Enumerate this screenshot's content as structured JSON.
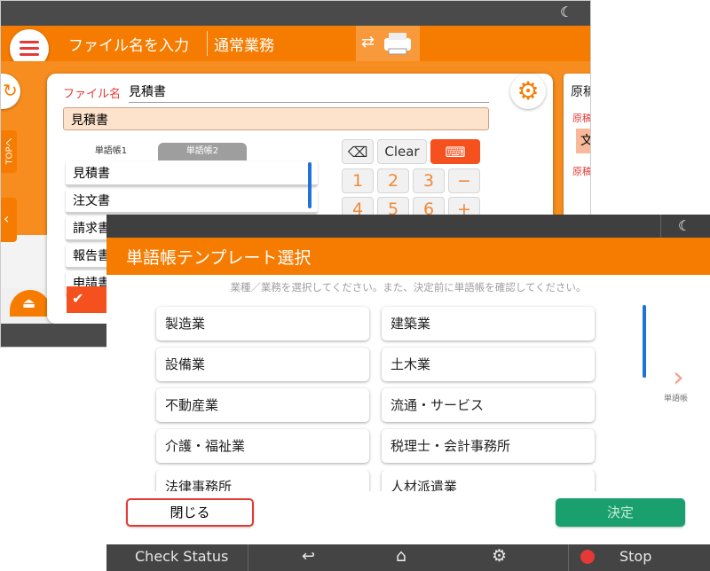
{
  "back_screen": {
    "header": {
      "filename_title": "ファイル名を入力",
      "mode": "通常業務"
    },
    "side_tab": "TOPへ",
    "filename_label": "ファイル名",
    "filename_value": "見積書",
    "preview_value": "見積書",
    "tabs": [
      "単語帳1",
      "単語帳2"
    ],
    "word_list": [
      "見積書",
      "注文書",
      "請求書",
      "報告書",
      "申請書"
    ],
    "keys": {
      "clear": "Clear",
      "row1": [
        "1",
        "2",
        "3",
        "−"
      ],
      "row2": [
        "4",
        "5",
        "6",
        "+"
      ]
    },
    "right_title": "原稿",
    "right_labels": [
      "原稿",
      "原稿"
    ],
    "right_chip": "文"
  },
  "front_screen": {
    "title": "単語帳テンプレート選択",
    "instruction": "業種／業務を選択してください。また、決定前に単語帳を確認してください。",
    "categories": [
      [
        "製造業",
        "建築業"
      ],
      [
        "設備業",
        "土木業"
      ],
      [
        "不動産業",
        "流通・サービス"
      ],
      [
        "介護・福祉業",
        "税理士・会計事務所"
      ],
      [
        "法律事務所",
        "人材派遣業"
      ]
    ],
    "next_label": "単語帳",
    "close_button": "閉じる",
    "ok_button": "決定",
    "bottom_bar": {
      "check_status": "Check Status",
      "stop": "Stop"
    }
  },
  "colors": {
    "accent": "#f57c00",
    "alert": "#e53935",
    "confirm": "#1aa06f",
    "bar": "#444444"
  },
  "icons": [
    "moon-icon",
    "menu-icon",
    "printer-icon",
    "gear-icon",
    "backspace-icon",
    "keyboard-icon",
    "eject-icon",
    "check-icon",
    "chevron-left-icon",
    "chevron-right-icon",
    "back-icon",
    "home-icon",
    "settings-icon",
    "stop-icon"
  ]
}
